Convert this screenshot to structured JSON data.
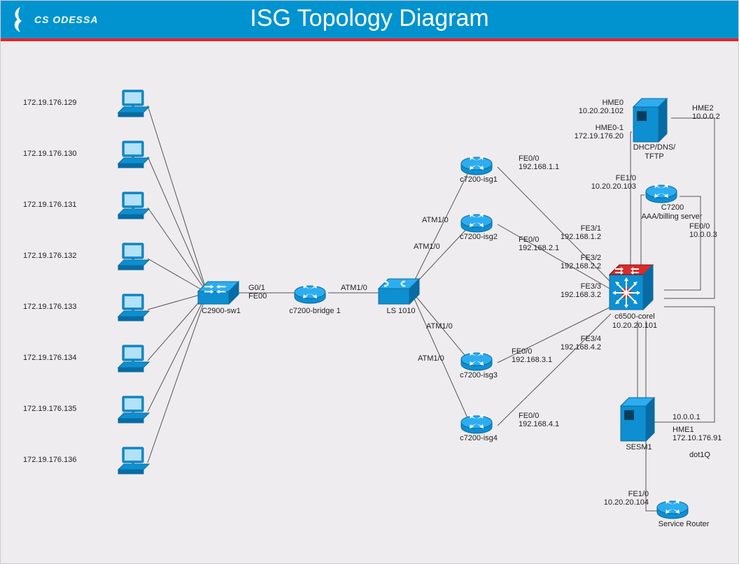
{
  "header": {
    "logo_text": "CS ODESSA",
    "title": "ISG Topology Diagram"
  },
  "workstations": [
    {
      "ip": "172.19.176.129"
    },
    {
      "ip": "172.19.176.130"
    },
    {
      "ip": "172.19.176.131"
    },
    {
      "ip": "172.19.176.132"
    },
    {
      "ip": "172.19.176.133"
    },
    {
      "ip": "172.19.176.134"
    },
    {
      "ip": "172.19.176.135"
    },
    {
      "ip": "172.19.176.136"
    }
  ],
  "devices": {
    "switch_c2900": {
      "label": "C2900-sw1"
    },
    "bridge_c7200": {
      "label": "c7200-bridge 1"
    },
    "ls1010": {
      "label": "LS 1010"
    },
    "isg1": {
      "label": "c7200-isg1"
    },
    "isg2": {
      "label": "c7200-isg2"
    },
    "isg3": {
      "label": "c7200-isg3"
    },
    "isg4": {
      "label": "c7200-isg4"
    },
    "core": {
      "label": "c6500-corel",
      "ip": "10.20.20.101"
    },
    "aaa": {
      "label": "C7200",
      "sub": "AAA/billing server"
    },
    "dhcp": {
      "label": "DHCP/DNS/",
      "sub": "TFTP"
    },
    "sesm": {
      "label": "SESM1"
    },
    "service_router": {
      "label": "Service Router"
    }
  },
  "link_labels": {
    "g01_fe00_a": "G0/1",
    "g01_fe00_b": "FE00",
    "atm10": "ATM1/0",
    "isg1_fe00_a": "FE0/0",
    "isg1_fe00_b": "192.168.1.1",
    "isg2_fe00_a": "FE0/0",
    "isg2_fe00_b": "192.168.2.1",
    "isg3_fe00_a": "FE0/0",
    "isg3_fe00_b": "192.168.3.1",
    "isg4_fe00_a": "FE0/0",
    "isg4_fe00_b": "192.168.4.1",
    "fe31_a": "FE3/1",
    "fe31_b": "192.168.1.2",
    "fe32_a": "FE3/2",
    "fe32_b": "192.168.2.2",
    "fe33_a": "FE3/3",
    "fe33_b": "192.168.3.2",
    "fe34_a": "FE3/4",
    "fe34_b": "192.168.4.2",
    "hme0_a": "HME0",
    "hme0_b": "10.20.20.102",
    "hme01_a": "HME0-1",
    "hme01_b": "172.19.176.20",
    "hme2_a": "HME2",
    "hme2_b": "10.0.0.2",
    "fe10_aaa_a": "FE1/0",
    "fe10_aaa_b": "10.20.20.103",
    "fe00_aaa_a": "FE0/0",
    "fe00_aaa_b": "10.0.0.3",
    "sesm_ip": "10.0.0.1",
    "hme1_a": "HME1",
    "hme1_b": "172.10.176.91",
    "dot1q": "dot1Q",
    "fe10_sr_a": "FE1/0",
    "fe10_sr_b": "10.20.20.104"
  }
}
